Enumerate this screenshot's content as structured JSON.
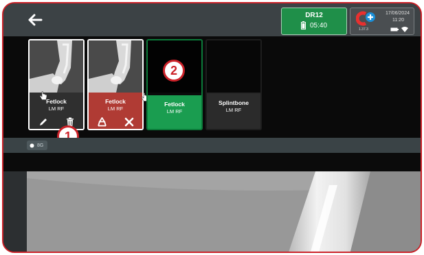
{
  "header": {
    "back_icon": "arrow-left-icon",
    "device": {
      "name": "DR12",
      "battery_icon": "battery-icon",
      "time": "05:40"
    },
    "system": {
      "app_logo_icon": "app-logo-icon",
      "version": "1.37.3",
      "date": "17/06/2024",
      "time": "11:20",
      "status_icons": [
        "battery-icon",
        "wifi-icon"
      ]
    }
  },
  "thumbnails": [
    {
      "name": "Fetlock",
      "sub": "LM RF",
      "state": "selected",
      "actions": [
        "pencil-icon",
        "trash-icon"
      ]
    },
    {
      "name": "Fetlock",
      "sub": "LM RF",
      "state": "delete-pending",
      "actions": [
        "recycle-icon",
        "close-icon"
      ]
    },
    {
      "name": "Fetlock",
      "sub": "LM RF",
      "state": "empty-active"
    },
    {
      "name": "Splintbone",
      "sub": "LM RF",
      "state": "empty"
    }
  ],
  "callouts": [
    "1",
    "2"
  ],
  "toolbar": {
    "chip_label": "8G",
    "chip_icon": "dot-icon"
  },
  "colors": {
    "accent_red": "#cc2229",
    "device_green": "#1f8f49",
    "active_green": "#1a9d50",
    "delete_red": "#b03b34"
  }
}
